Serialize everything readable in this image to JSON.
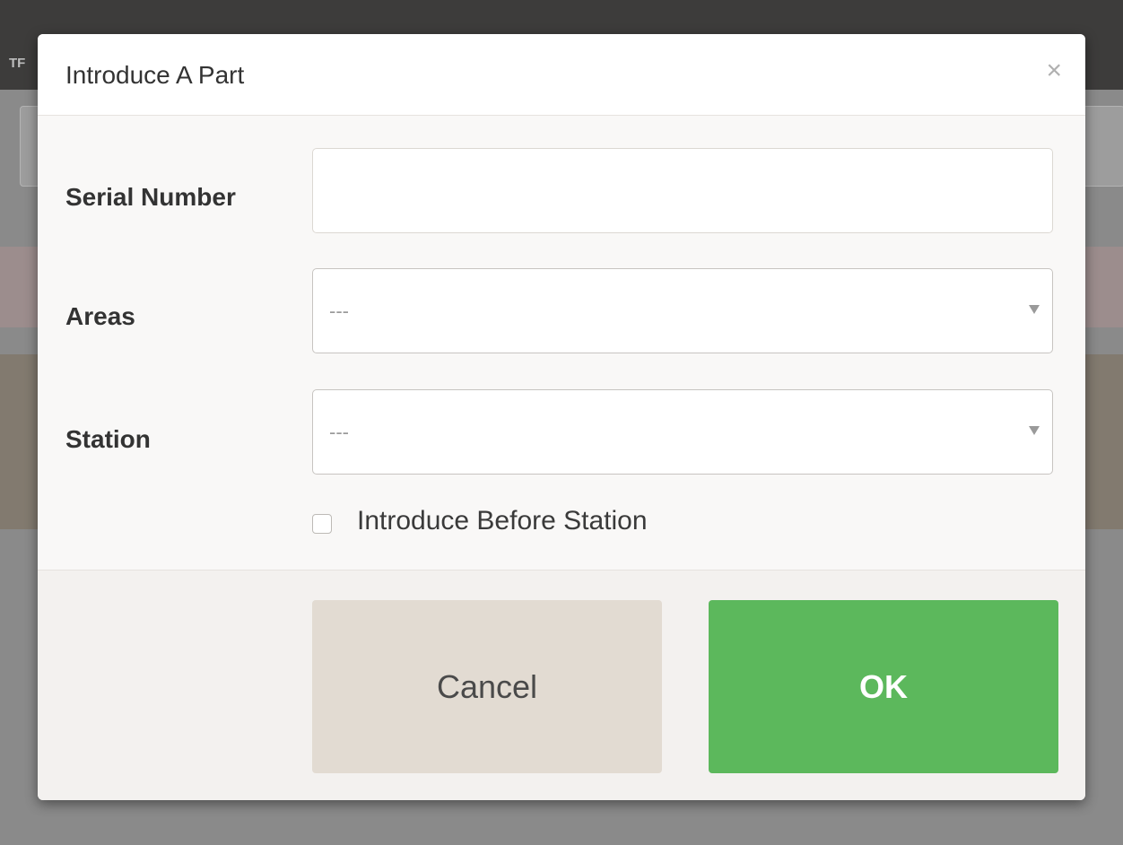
{
  "background": {
    "title_fragment": "TF"
  },
  "dialog": {
    "title": "Introduce A Part",
    "close_glyph": "×",
    "fields": {
      "serial_number": {
        "label": "Serial Number",
        "value": "",
        "placeholder": ""
      },
      "areas": {
        "label": "Areas",
        "selected": "---"
      },
      "station": {
        "label": "Station",
        "selected": "---"
      }
    },
    "checkbox": {
      "label": "Introduce Before Station",
      "checked": false
    },
    "buttons": {
      "cancel": "Cancel",
      "ok": "OK"
    }
  },
  "colors": {
    "ok_button": "#5cb85c",
    "cancel_button": "#e2dbd2",
    "overlay": "#8a8a8a"
  }
}
